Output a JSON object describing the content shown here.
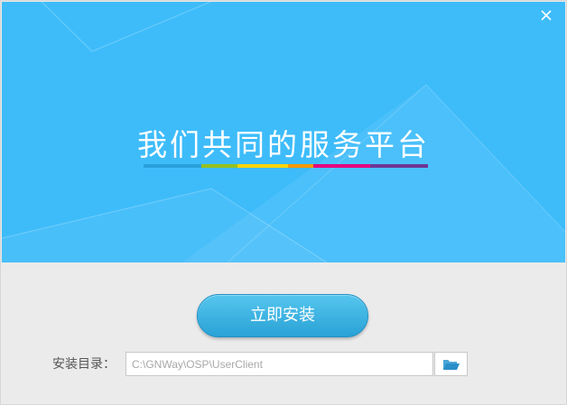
{
  "banner": {
    "slogan": "我们共同的服务平台",
    "rainbow_colors": [
      "#2aa0db",
      "#95c11f",
      "#ffd400",
      "#f39800",
      "#e4007f",
      "#6f3596"
    ]
  },
  "install": {
    "button_label": "立即安装"
  },
  "directory": {
    "label": "安装目录：",
    "value": "C:\\GNWay\\OSP\\UserClient"
  },
  "icons": {
    "close": "close-icon",
    "folder": "folder-open-icon"
  },
  "colors": {
    "banner_bg": "#3ebcfa",
    "button": "#2aa2d6",
    "footer_bg": "#ebebeb",
    "folder_icon": "#2a8fc9"
  }
}
